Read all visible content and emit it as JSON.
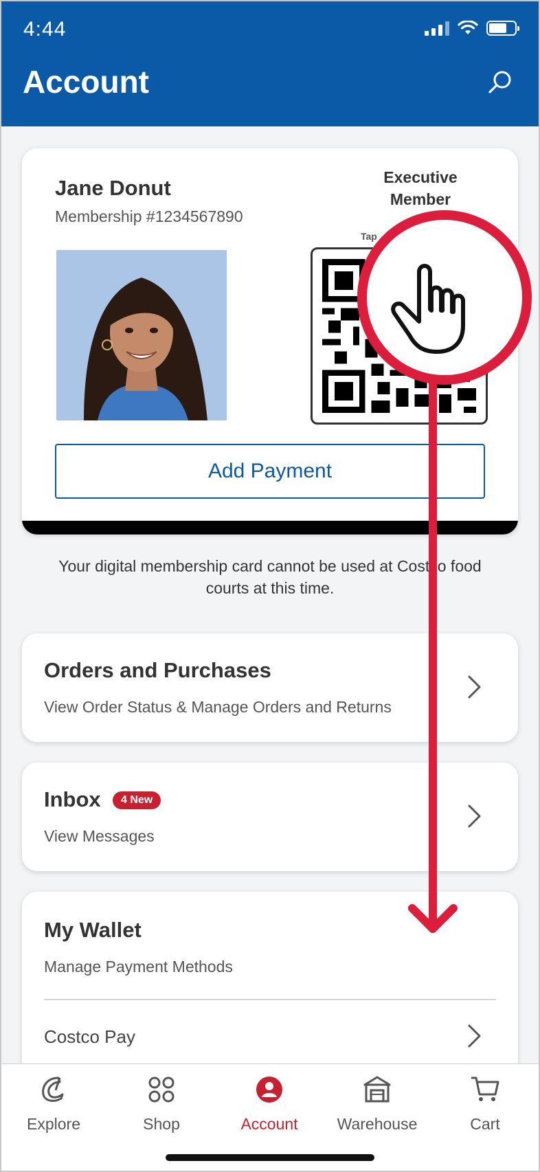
{
  "status_bar": {
    "time": "4:44"
  },
  "header": {
    "title": "Account"
  },
  "member_card": {
    "name": "Jane Donut",
    "membership_number": "Membership #1234567890",
    "member_type": "Executive Member",
    "tag_partial": "Tap",
    "add_payment_label": "Add Payment"
  },
  "notice": "Your digital membership card cannot be used at Costco food courts at this time.",
  "menu": {
    "orders": {
      "title": "Orders and Purchases",
      "subtitle": "View Order Status & Manage Orders and Returns"
    },
    "inbox": {
      "title": "Inbox",
      "badge": "4 New",
      "subtitle": "View Messages"
    },
    "wallet": {
      "title": "My Wallet",
      "subtitle": "Manage Payment Methods",
      "item": "Costco Pay"
    }
  },
  "bottom_nav": {
    "items": [
      {
        "label": "Explore",
        "icon": "explore-icon"
      },
      {
        "label": "Shop",
        "icon": "grid-icon"
      },
      {
        "label": "Account",
        "icon": "user-icon",
        "active": true
      },
      {
        "label": "Warehouse",
        "icon": "store-icon"
      },
      {
        "label": "Cart",
        "icon": "cart-icon"
      }
    ]
  },
  "colors": {
    "brand_blue": "#0a5aa8",
    "accent_red": "#c8202f",
    "gesture_red": "#dc1e3c"
  }
}
